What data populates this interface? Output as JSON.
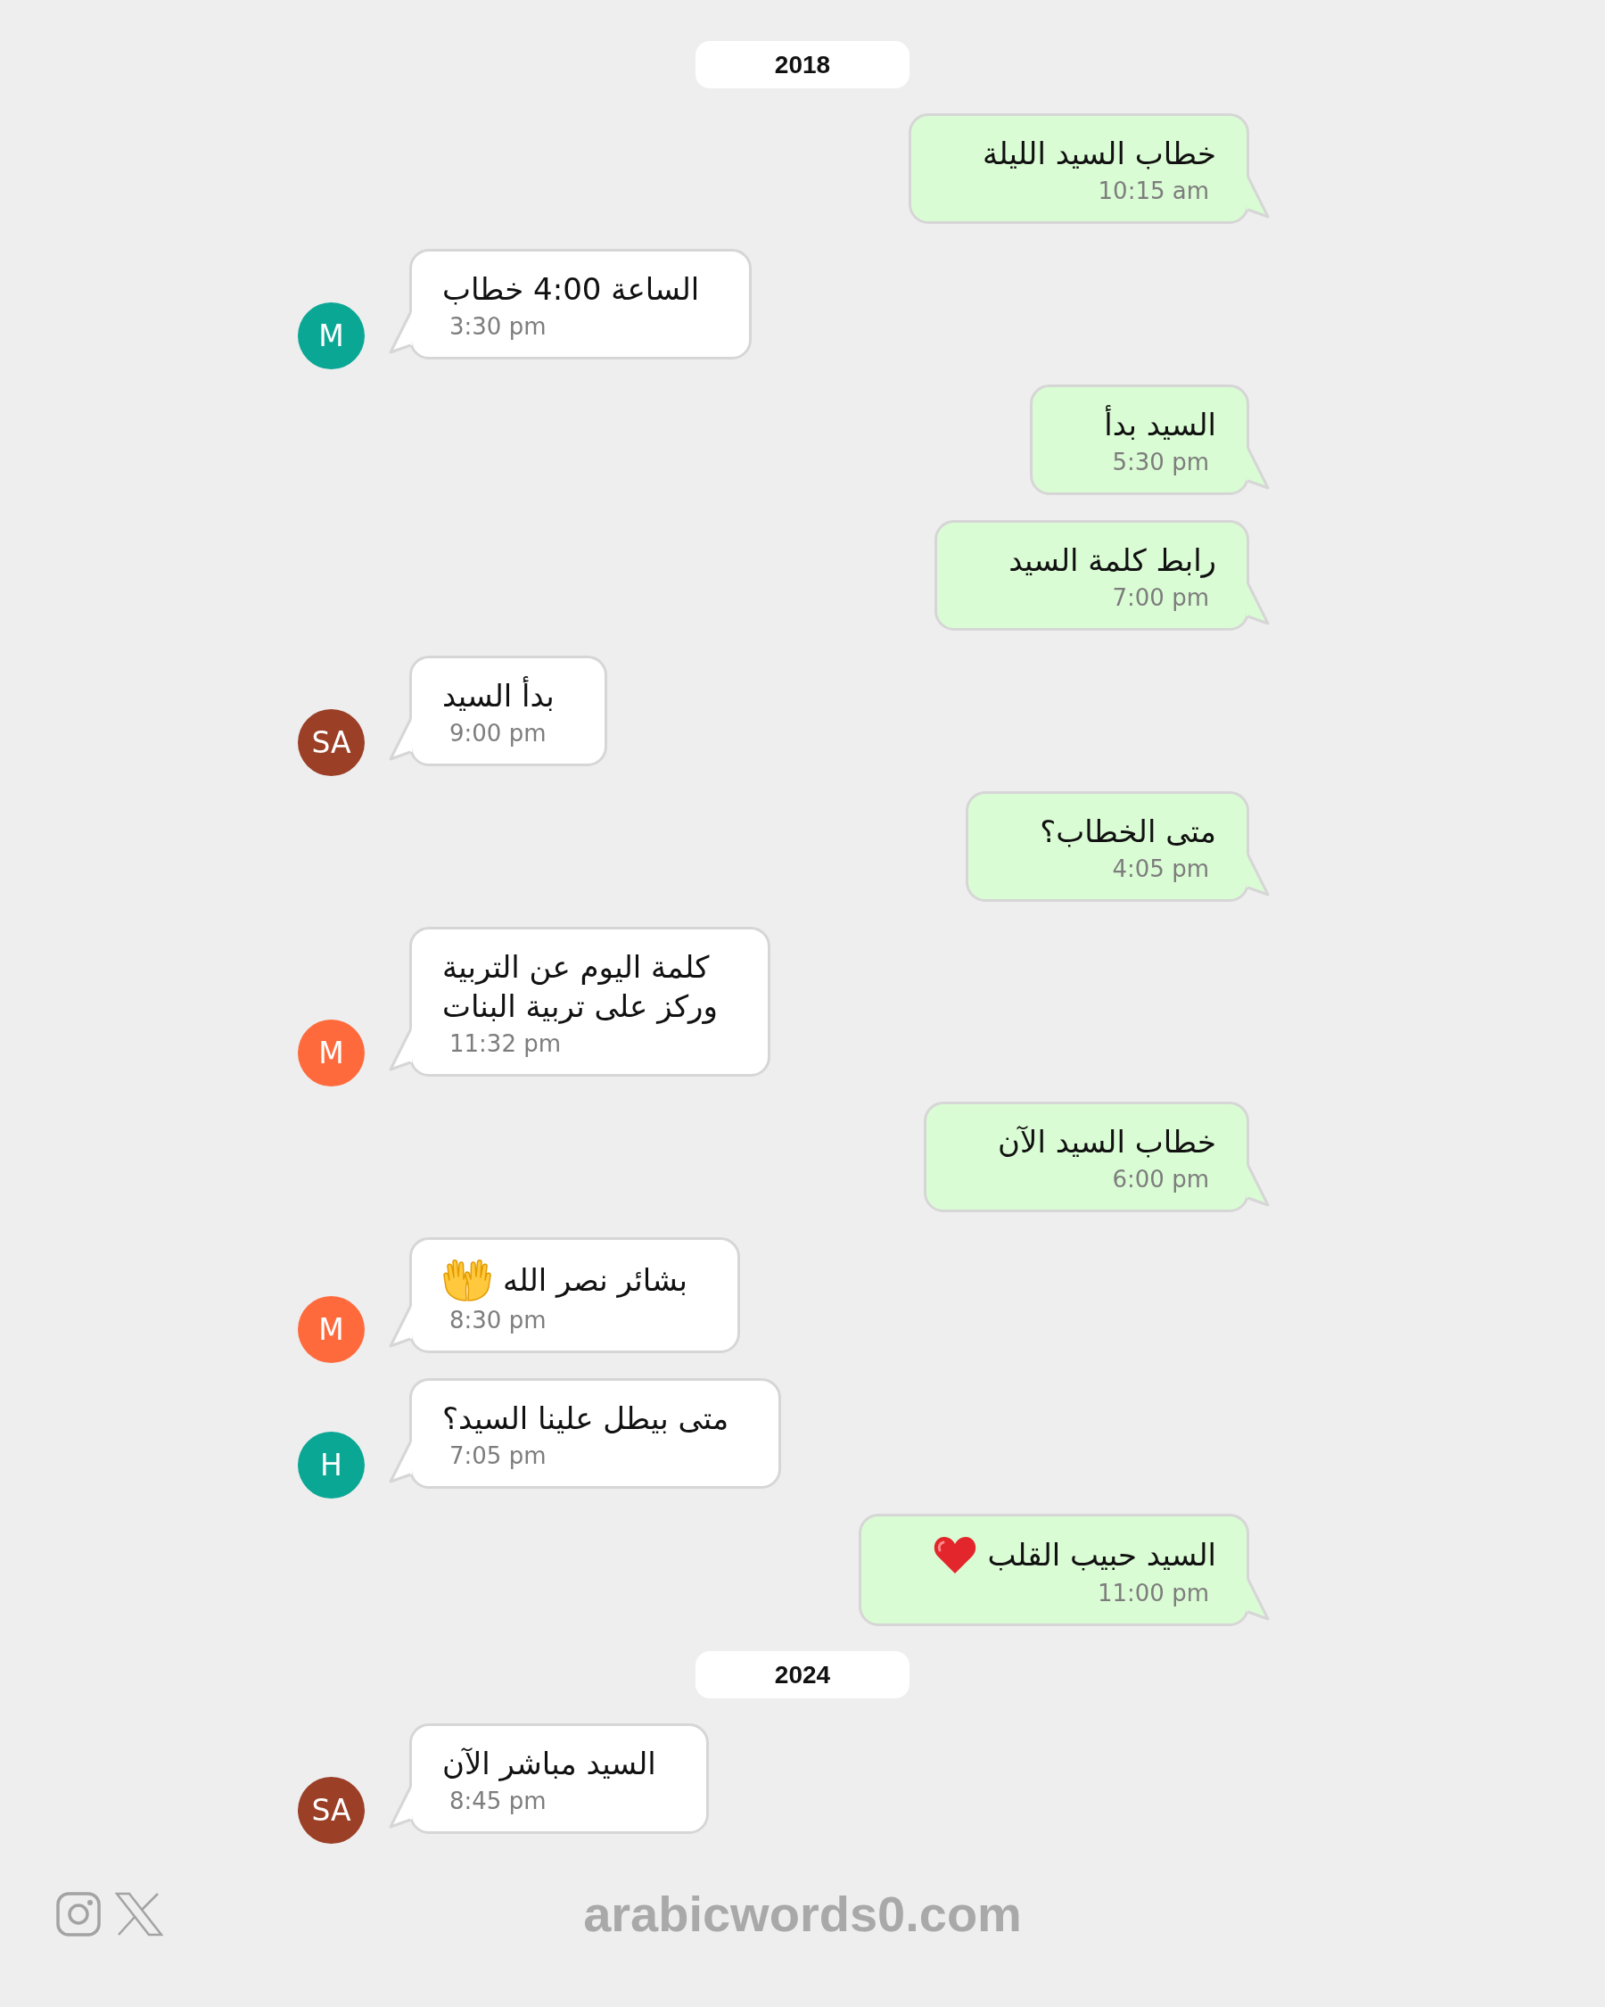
{
  "timeline": [
    {
      "kind": "date",
      "label": "2018"
    },
    {
      "kind": "sent",
      "text": "خطاب السيد الليلة",
      "time": "10:15 am"
    },
    {
      "kind": "received",
      "avatar": {
        "initials": "M",
        "color": "#0ba795"
      },
      "text": "الساعة 4:00 خطاب",
      "time": "3:30 pm"
    },
    {
      "kind": "sent",
      "text": "السيد بدأ",
      "time": "5:30 pm"
    },
    {
      "kind": "sent",
      "text": "رابط كلمة السيد",
      "time": "7:00 pm"
    },
    {
      "kind": "received",
      "avatar": {
        "initials": "SA",
        "color": "#9b3f27"
      },
      "text": "بدأ السيد",
      "time": "9:00 pm"
    },
    {
      "kind": "sent",
      "text": "متى الخطاب؟",
      "time": "4:05 pm"
    },
    {
      "kind": "received",
      "avatar": {
        "initials": "M",
        "color": "#ff6a3c"
      },
      "text": "كلمة اليوم عن التربية\nوركز على تربية البنات",
      "time": "11:32 pm"
    },
    {
      "kind": "sent",
      "text": "خطاب السيد الآن",
      "time": "6:00 pm"
    },
    {
      "kind": "received",
      "avatar": {
        "initials": "M",
        "color": "#ff6a3c"
      },
      "text": "بشائر نصر الله",
      "emoji": {
        "kind": "palms"
      },
      "time": "8:30 pm"
    },
    {
      "kind": "received",
      "avatar": {
        "initials": "H",
        "color": "#0ba795"
      },
      "text": "متى بيطل علينا السيد؟",
      "time": "7:05 pm"
    },
    {
      "kind": "sent",
      "text": "السيد حبيب القلب",
      "emoji": {
        "kind": "heart"
      },
      "time": "11:00 pm"
    },
    {
      "kind": "date",
      "label": "2024"
    },
    {
      "kind": "received",
      "avatar": {
        "initials": "SA",
        "color": "#9b3f27"
      },
      "text": "السيد مباشر الآن",
      "time": "8:45 pm"
    }
  ],
  "footer": {
    "website": "arabicwords0.com"
  }
}
